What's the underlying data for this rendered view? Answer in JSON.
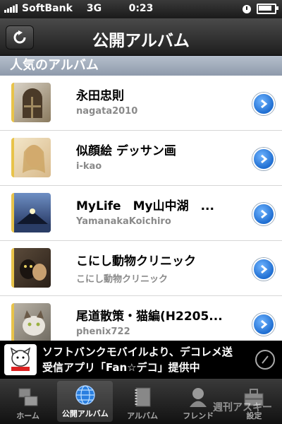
{
  "status_bar": {
    "carrier": "SoftBank",
    "network": "3G",
    "time": "0:23"
  },
  "nav": {
    "title": "公開アルバム",
    "refresh_icon": "refresh-icon"
  },
  "section": {
    "title": "人気のアルバム"
  },
  "albums": [
    {
      "title": "永田忠則",
      "user": "nagata2010"
    },
    {
      "title": "似顔絵 デッサン画",
      "user": "i-kao"
    },
    {
      "title": "MyLife　My山中湖　...",
      "user": "YamanakaKoichiro"
    },
    {
      "title": "こにし動物クリニック",
      "user": "こにし動物クリニック"
    },
    {
      "title": "尾道散策・猫編(H2205...",
      "user": "phenix722"
    }
  ],
  "ad": {
    "text": "ソフトバンクモバイルより、デコレメ送受信アプリ「Fan☆デコ」提供中"
  },
  "tabs": [
    {
      "label": "ホーム",
      "icon": "home-icon"
    },
    {
      "label": "公開アルバム",
      "icon": "globe-icon"
    },
    {
      "label": "アルバム",
      "icon": "album-icon"
    },
    {
      "label": "フレンド",
      "icon": "friend-icon"
    },
    {
      "label": "設定",
      "icon": "toolbox-icon"
    }
  ],
  "watermark": "週刊アスキー",
  "colors": {
    "accent_blue": "#1f6ed1",
    "section_header": "#9aa6b6",
    "nav_bar": "#2a2a2a"
  }
}
